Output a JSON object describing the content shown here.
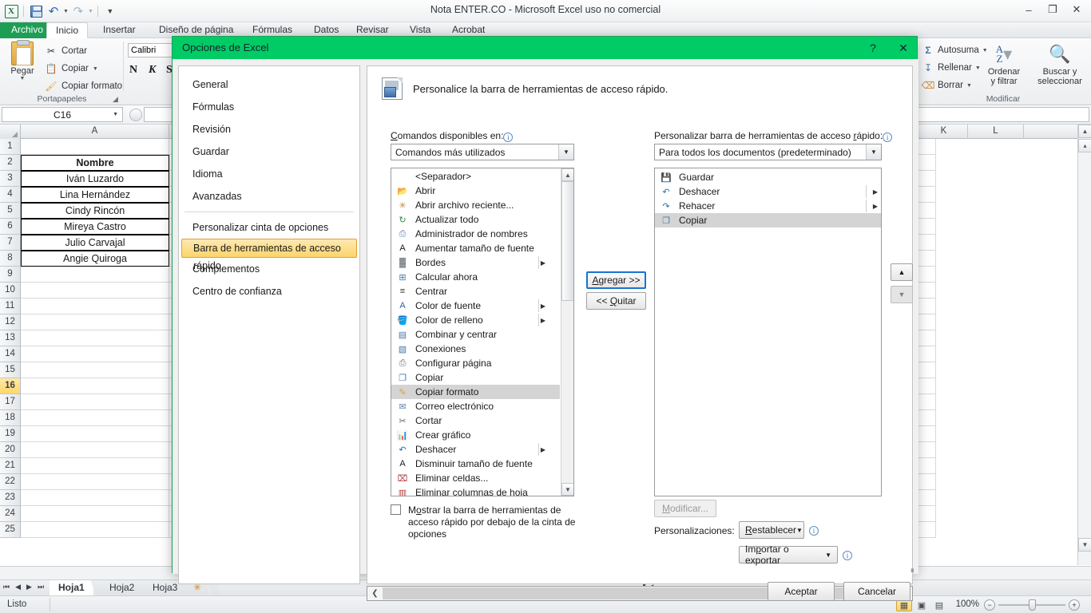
{
  "app": {
    "title": "Nota ENTER.CO  -  Microsoft Excel uso no comercial",
    "qat": [
      {
        "name": "save",
        "icon": "save-icon"
      },
      {
        "name": "undo",
        "icon": "undo-icon"
      },
      {
        "name": "redo",
        "icon": "redo-icon"
      },
      {
        "name": "customize",
        "icon": "qat-dropdown-icon"
      }
    ],
    "window_buttons": {
      "minimize": "–",
      "maximize": "❐",
      "close": "✕"
    }
  },
  "ribbon": {
    "tabs": [
      {
        "label": "Archivo",
        "active": false,
        "file": true
      },
      {
        "label": "Inicio",
        "active": true
      },
      {
        "label": "Insertar",
        "active": false
      },
      {
        "label": "Diseño de página",
        "active": false
      },
      {
        "label": "Fórmulas",
        "active": false
      },
      {
        "label": "Datos",
        "active": false
      },
      {
        "label": "Revisar",
        "active": false
      },
      {
        "label": "Vista",
        "active": false
      },
      {
        "label": "Acrobat",
        "active": false
      }
    ],
    "clipboard": {
      "group_label": "Portapapeles",
      "paste": "Pegar",
      "cut": "Cortar",
      "copy": "Copiar",
      "format_painter": "Copiar formato"
    },
    "font": {
      "font_name": "Calibri",
      "bold": "N",
      "italic": "K",
      "underline": "S"
    },
    "editing": {
      "group_label": "Modificar",
      "autosum": "Autosuma",
      "fill": "Rellenar",
      "clear": "Borrar",
      "sort_filter_line1": "Ordenar",
      "sort_filter_line2": "y filtrar",
      "find_select_line1": "Buscar y",
      "find_select_line2": "seleccionar"
    }
  },
  "formula_bar": {
    "name_box": "C16",
    "formula": ""
  },
  "sheet": {
    "columns": [
      "A",
      "K",
      "L"
    ],
    "rows": [
      "1",
      "2",
      "3",
      "4",
      "5",
      "6",
      "7",
      "8",
      "9",
      "10",
      "11",
      "12",
      "13",
      "14",
      "15",
      "16",
      "17",
      "18",
      "19",
      "20",
      "21",
      "22",
      "23",
      "24",
      "25"
    ],
    "selected_row": "16",
    "column_a_values": [
      {
        "row": "1",
        "value": "",
        "boxed": false,
        "bold": false
      },
      {
        "row": "2",
        "value": "Nombre",
        "boxed": true,
        "bold": true
      },
      {
        "row": "3",
        "value": "Iván Luzardo",
        "boxed": true,
        "bold": false
      },
      {
        "row": "4",
        "value": "Lina Hernández",
        "boxed": true,
        "bold": false
      },
      {
        "row": "5",
        "value": "Cindy Rincón",
        "boxed": true,
        "bold": false
      },
      {
        "row": "6",
        "value": "Mireya Castro",
        "boxed": true,
        "bold": false
      },
      {
        "row": "7",
        "value": "Julio Carvajal",
        "boxed": true,
        "bold": false
      },
      {
        "row": "8",
        "value": "Angie Quiroga",
        "boxed": true,
        "bold": false
      }
    ]
  },
  "sheet_tabs": {
    "tabs": [
      "Hoja1",
      "Hoja2",
      "Hoja3"
    ],
    "active": "Hoja1",
    "insert_label": "✳"
  },
  "status_bar": {
    "state": "Listo",
    "zoom": "100%",
    "views": [
      "normal-view",
      "page-layout-view",
      "page-break-view"
    ]
  },
  "dialog": {
    "title": "Opciones de Excel",
    "help_button": "?",
    "close_button": "✕",
    "nav_items": [
      {
        "label": "General",
        "selected": false
      },
      {
        "label": "Fórmulas",
        "selected": false
      },
      {
        "label": "Revisión",
        "selected": false
      },
      {
        "label": "Guardar",
        "selected": false
      },
      {
        "label": "Idioma",
        "selected": false
      },
      {
        "label": "Avanzadas",
        "selected": false
      },
      {
        "label": "Personalizar cinta de opciones",
        "selected": false
      },
      {
        "label": "Barra de herramientas de acceso rápido",
        "selected": true
      },
      {
        "label": "Complementos",
        "selected": false
      },
      {
        "label": "Centro de confianza",
        "selected": false
      }
    ],
    "header": "Personalice la barra de herramientas de acceso rápido.",
    "left": {
      "label": "Comandos disponibles en:",
      "label_accel": "C",
      "combo_value": "Comandos más utilizados",
      "commands": [
        {
          "label": "<Separador>",
          "icon": "separator-icon",
          "submenu": false,
          "selected": false,
          "noicon": true
        },
        {
          "label": "Abrir",
          "icon": "open-folder-icon",
          "submenu": false,
          "selected": false
        },
        {
          "label": "Abrir archivo reciente...",
          "icon": "recent-file-icon",
          "submenu": false,
          "selected": false
        },
        {
          "label": "Actualizar todo",
          "icon": "refresh-all-icon",
          "submenu": false,
          "selected": false
        },
        {
          "label": "Administrador de nombres",
          "icon": "name-manager-icon",
          "submenu": false,
          "selected": false
        },
        {
          "label": "Aumentar tamaño de fuente",
          "icon": "increase-font-icon",
          "submenu": false,
          "selected": false
        },
        {
          "label": "Bordes",
          "icon": "borders-icon",
          "submenu": true,
          "selected": false
        },
        {
          "label": "Calcular ahora",
          "icon": "calculate-now-icon",
          "submenu": false,
          "selected": false
        },
        {
          "label": "Centrar",
          "icon": "center-align-icon",
          "submenu": false,
          "selected": false
        },
        {
          "label": "Color de fuente",
          "icon": "font-color-icon",
          "submenu": true,
          "selected": false
        },
        {
          "label": "Color de relleno",
          "icon": "fill-color-icon",
          "submenu": true,
          "selected": false
        },
        {
          "label": "Combinar y centrar",
          "icon": "merge-center-icon",
          "submenu": false,
          "selected": false
        },
        {
          "label": "Conexiones",
          "icon": "connections-icon",
          "submenu": false,
          "selected": false
        },
        {
          "label": "Configurar página",
          "icon": "page-setup-icon",
          "submenu": false,
          "selected": false
        },
        {
          "label": "Copiar",
          "icon": "copy-icon",
          "submenu": false,
          "selected": false
        },
        {
          "label": "Copiar formato",
          "icon": "format-painter-icon",
          "submenu": false,
          "selected": true
        },
        {
          "label": "Correo electrónico",
          "icon": "email-icon",
          "submenu": false,
          "selected": false
        },
        {
          "label": "Cortar",
          "icon": "cut-icon",
          "submenu": false,
          "selected": false
        },
        {
          "label": "Crear gráfico",
          "icon": "create-chart-icon",
          "submenu": false,
          "selected": false
        },
        {
          "label": "Deshacer",
          "icon": "undo-icon",
          "submenu": true,
          "selected": false
        },
        {
          "label": "Disminuir tamaño de fuente",
          "icon": "decrease-font-icon",
          "submenu": false,
          "selected": false
        },
        {
          "label": "Eliminar celdas...",
          "icon": "delete-cells-icon",
          "submenu": false,
          "selected": false
        },
        {
          "label": "Eliminar columnas de hoja",
          "icon": "delete-columns-icon",
          "submenu": false,
          "selected": false
        }
      ],
      "checkbox": {
        "checked": false,
        "label": "Mostrar la barra de herramientas de acceso rápido por debajo de la cinta de opciones"
      }
    },
    "middle_buttons": {
      "add": "Agregar >>",
      "remove": "<< Quitar"
    },
    "right": {
      "label": "Personalizar barra de herramientas de acceso rápido:",
      "combo_value": "Para todos los documentos (predeterminado)",
      "items": [
        {
          "label": "Guardar",
          "icon": "save-icon",
          "submenu": false,
          "selected": false
        },
        {
          "label": "Deshacer",
          "icon": "undo-icon",
          "submenu": true,
          "selected": false
        },
        {
          "label": "Rehacer",
          "icon": "redo-icon",
          "submenu": true,
          "selected": false
        },
        {
          "label": "Copiar",
          "icon": "copy-icon",
          "submenu": false,
          "selected": true
        }
      ],
      "move_up": "move-up-icon",
      "move_down": "move-down-icon",
      "modify_button": "Modificar...",
      "customizations_label": "Personalizaciones:",
      "reset_button": "Restablecer",
      "import_export_button": "Importar o exportar"
    },
    "footer": {
      "ok": "Aceptar",
      "cancel": "Cancelar"
    }
  }
}
